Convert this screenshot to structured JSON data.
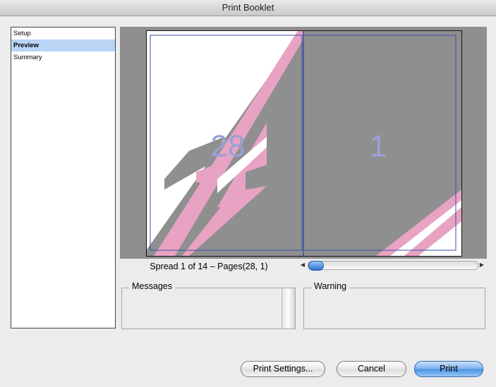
{
  "window": {
    "title": "Print Booklet"
  },
  "sidebar": {
    "items": [
      {
        "label": "Setup",
        "selected": false
      },
      {
        "label": "Preview",
        "selected": true
      },
      {
        "label": "Summary",
        "selected": false
      }
    ]
  },
  "preview": {
    "left_page_number": "28",
    "right_page_number": "1",
    "spread_label": "Spread 1 of 14 – Pages(28, 1)"
  },
  "scrollbar": {
    "position_fraction": 0.0
  },
  "groups": {
    "messages_title": "Messages",
    "warning_title": "Warning"
  },
  "buttons": {
    "print_settings": "Print Settings...",
    "cancel": "Cancel",
    "print": "Print"
  },
  "colors": {
    "accent_pink": "#e8a3c3",
    "page_number_blue": "#9aa0d8",
    "selection": "#b9d4f5"
  }
}
